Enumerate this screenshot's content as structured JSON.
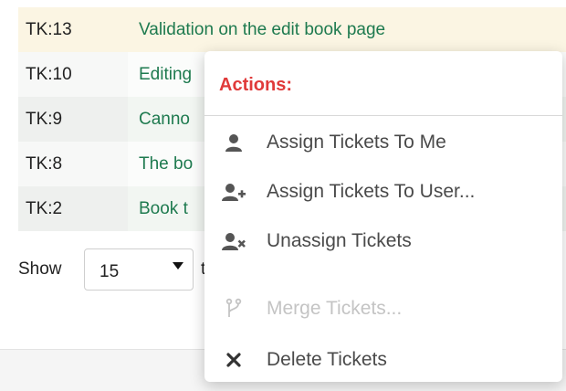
{
  "tickets": [
    {
      "id": "TK:13",
      "title": "Validation on the edit book page"
    },
    {
      "id": "TK:10",
      "title": "Editing"
    },
    {
      "id": "TK:9",
      "title": "Canno"
    },
    {
      "id": "TK:8",
      "title": "The bo"
    },
    {
      "id": "TK:2",
      "title": "Book t"
    }
  ],
  "pagination": {
    "show_label": "Show",
    "page_size": "15",
    "after_text": "t"
  },
  "actions_menu": {
    "header": "Actions:",
    "items": [
      {
        "label": "Assign Tickets To Me",
        "icon": "user-icon",
        "disabled": false
      },
      {
        "label": "Assign Tickets To User...",
        "icon": "user-plus-icon",
        "disabled": false
      },
      {
        "label": "Unassign Tickets",
        "icon": "user-times-icon",
        "disabled": false
      },
      {
        "label": "Merge Tickets...",
        "icon": "merge-icon",
        "disabled": true
      },
      {
        "label": "Delete Tickets",
        "icon": "close-icon",
        "disabled": false
      }
    ]
  },
  "colors": {
    "link": "#1e7a4f",
    "highlight_row": "#fbf5e3",
    "menu_header": "#e03a3a",
    "disabled_text": "#c4c4c4"
  }
}
